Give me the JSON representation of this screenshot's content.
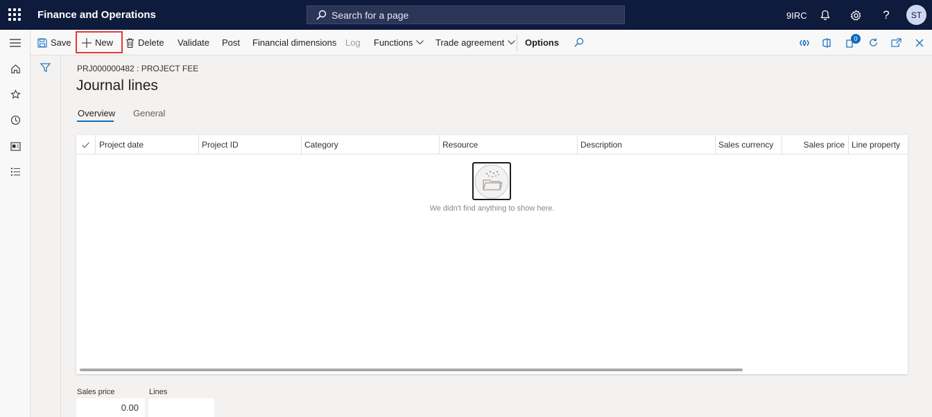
{
  "topbar": {
    "app_title": "Finance and Operations",
    "search_placeholder": "Search for a page",
    "company": "9IRC",
    "avatar_initials": "ST",
    "bg_color": "#0f1b3d"
  },
  "actions": {
    "save": "Save",
    "new": "New",
    "delete": "Delete",
    "validate": "Validate",
    "post": "Post",
    "financial_dimensions": "Financial dimensions",
    "log": "Log",
    "functions": "Functions",
    "trade_agreement": "Trade agreement",
    "options": "Options",
    "notification_count": "0"
  },
  "icons": {
    "left_nav": [
      "hamburger-icon",
      "home-icon",
      "star-icon",
      "clock-icon",
      "workspace-icon",
      "list-icon"
    ],
    "top_right": [
      "bell-icon",
      "gear-icon",
      "help-icon"
    ],
    "action_right": [
      "diamond-icon",
      "office-icon",
      "badge-icon",
      "refresh-icon",
      "open-new-icon",
      "close-icon"
    ]
  },
  "page": {
    "caption": "PRJ000000482 : PROJECT FEE",
    "title": "Journal lines",
    "tabs": [
      "Overview",
      "General"
    ]
  },
  "grid": {
    "columns": [
      "Project date",
      "Project ID",
      "Category",
      "Resource",
      "Description",
      "Sales currency",
      "Sales price",
      "Line property"
    ],
    "empty_text": "We didn't find anything to show here."
  },
  "footer": {
    "sales_price_label": "Sales price",
    "sales_price_value": "0.00",
    "lines_label": "Lines",
    "lines_value": ""
  },
  "colors": {
    "accent": "#0f6cbd",
    "highlight": "#e03a3a"
  }
}
